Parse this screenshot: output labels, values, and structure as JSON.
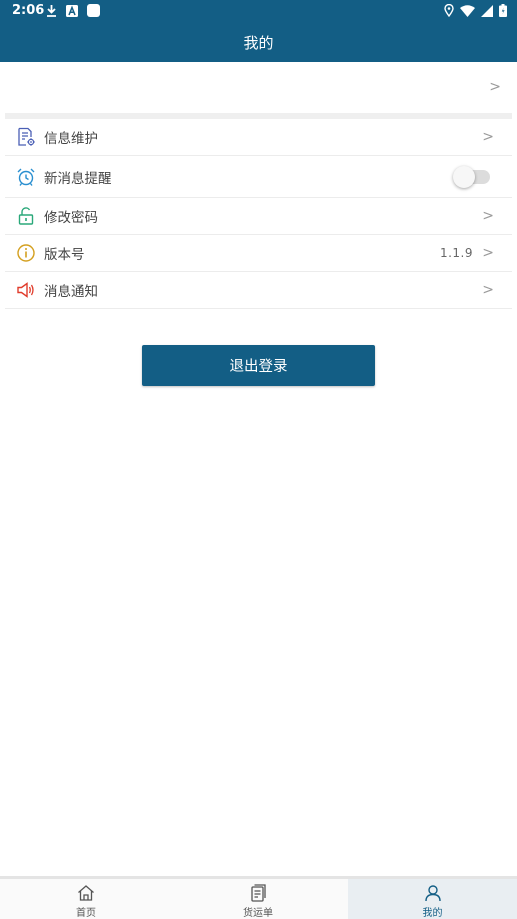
{
  "status_bar": {
    "time": "2:06",
    "left_icons": [
      "download-icon",
      "font-a-icon",
      "square-app-icon"
    ],
    "right_icons": [
      "location-icon",
      "wifi-icon",
      "signal-icon",
      "battery-icon"
    ]
  },
  "app_bar": {
    "title": "我的"
  },
  "profile_row": {
    "chevron": ">"
  },
  "settings": [
    {
      "label": "信息维护",
      "icon": "doc-settings-icon",
      "chevron": ">"
    },
    {
      "label": "新消息提醒",
      "icon": "alarm-clock-icon",
      "toggle_on": false
    },
    {
      "label": "修改密码",
      "icon": "unlock-icon",
      "chevron": ">"
    },
    {
      "label": "版本号",
      "icon": "info-icon",
      "value": "1.1.9",
      "chevron": ">"
    },
    {
      "label": "消息通知",
      "icon": "megaphone-icon",
      "chevron": ">"
    }
  ],
  "logout_label": "退出登录",
  "bottom_nav": [
    {
      "label": "首页",
      "icon": "home-icon",
      "active": false
    },
    {
      "label": "货运单",
      "icon": "waybill-icon",
      "active": false
    },
    {
      "label": "我的",
      "icon": "person-icon",
      "active": true
    }
  ],
  "colors": {
    "primary": "#135e85",
    "doc_icon": "#4a5fb5",
    "clock_icon": "#2a8fd0",
    "lock_icon": "#2aa87a",
    "info_icon": "#d4a020",
    "megaphone_icon": "#e03c2c"
  }
}
